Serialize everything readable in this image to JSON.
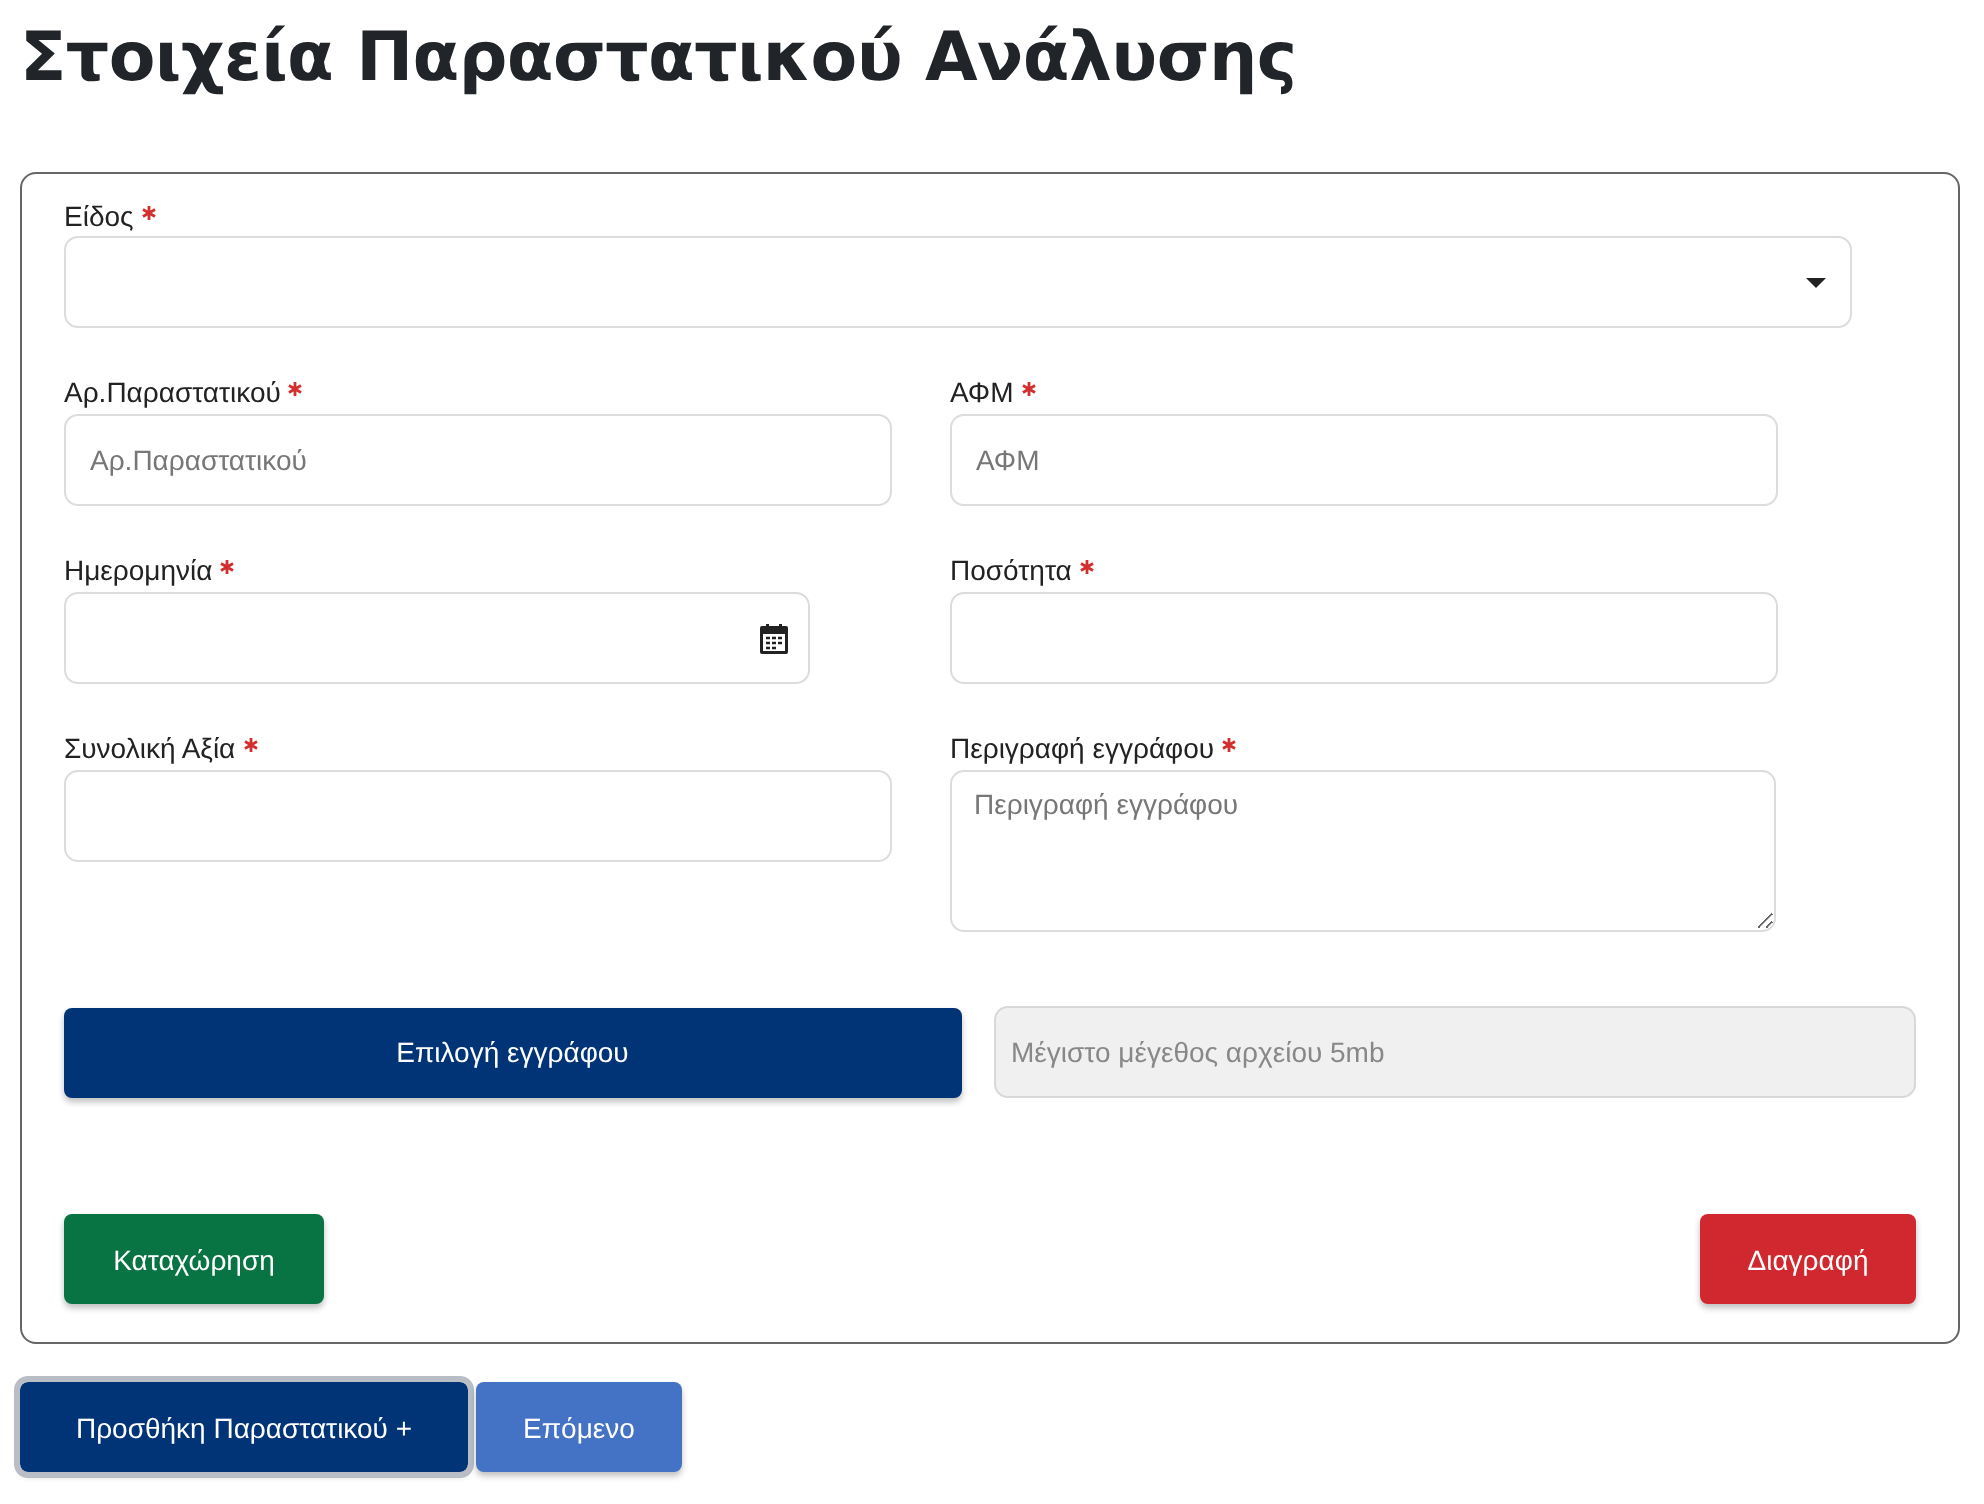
{
  "title": "Στοιχεία Παραστατικού Ανάλυσης",
  "fields": [
    {
      "kind": "select",
      "label": "Είδος",
      "required": true
    },
    {
      "kind": "text",
      "label": "Αρ.Παραστατικού",
      "required": true,
      "placeholder": "Αρ.Παραστατικού"
    },
    {
      "kind": "text",
      "label": "ΑΦΜ",
      "required": true,
      "placeholder": "ΑΦΜ"
    },
    {
      "kind": "date",
      "label": "Ημερομηνία",
      "required": true
    },
    {
      "kind": "text",
      "label": "Ποσότητα",
      "required": true
    },
    {
      "kind": "text",
      "label": "Συνολική Αξία",
      "required": true
    },
    {
      "kind": "textarea",
      "label": "Περιγραφή εγγράφου",
      "required": true,
      "placeholder": "Περιγραφή εγγράφου"
    }
  ],
  "file": {
    "button": "Επιλογή εγγράφου",
    "hint": "Μέγιστο μέγεθος αρχείου 5mb"
  },
  "actions": [
    {
      "kind": "save",
      "label": "Καταχώρηση"
    },
    {
      "kind": "delete",
      "label": "Διαγραφή"
    }
  ],
  "footer_buttons": [
    {
      "kind": "primary",
      "label": "Προσθήκη Παραστατικού +",
      "focused": true
    },
    {
      "kind": "secondary",
      "label": "Επόμενο",
      "focused": false
    }
  ]
}
